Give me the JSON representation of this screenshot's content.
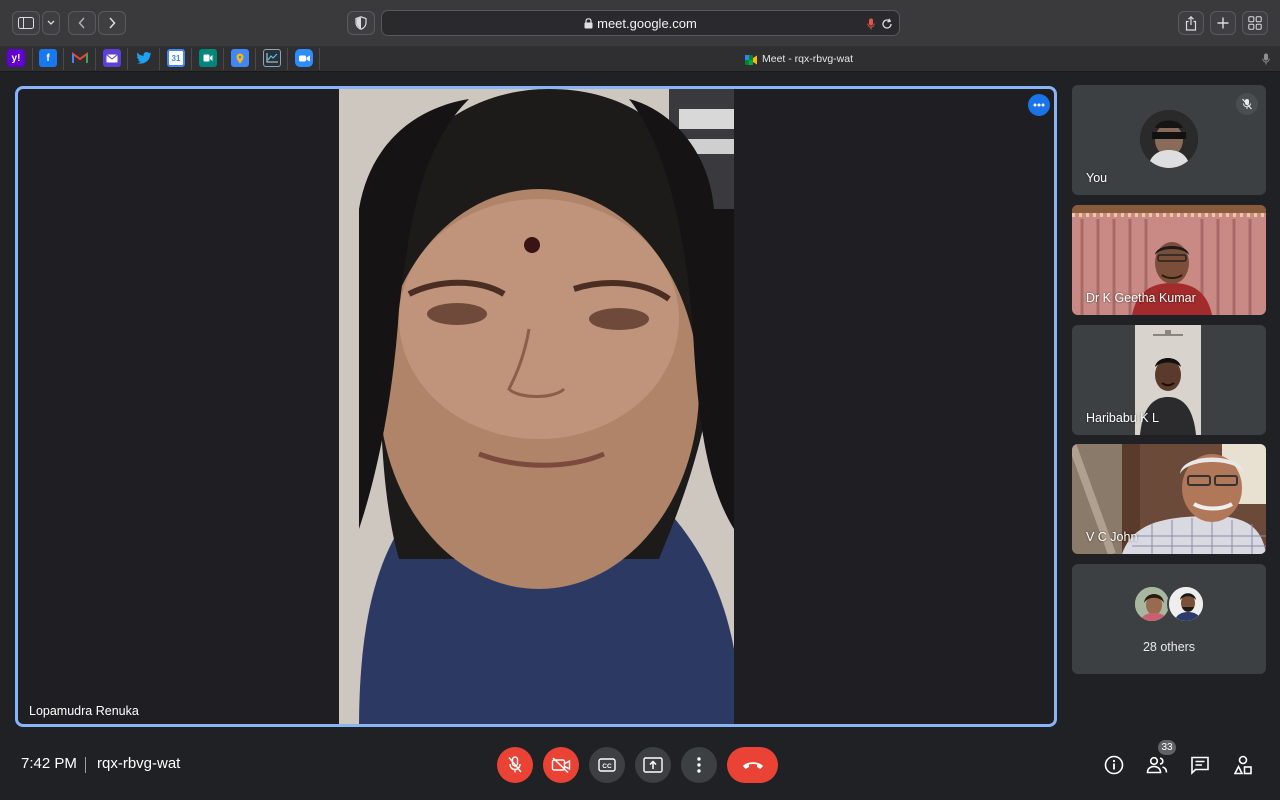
{
  "browser": {
    "url": "meet.google.com",
    "tab_title": "Meet - rqx-rbvg-wat",
    "bookmarks": [
      {
        "name": "yahoo",
        "glyph": "y!",
        "color": "#6001d2"
      },
      {
        "name": "facebook",
        "glyph": "f",
        "color": "#1877f2"
      },
      {
        "name": "gmail",
        "glyph": "M",
        "color": "#ffffff"
      },
      {
        "name": "mail",
        "glyph": "",
        "color": "#5b3fd6"
      },
      {
        "name": "twitter",
        "glyph": "",
        "color": "#1da1f2"
      },
      {
        "name": "calendar",
        "glyph": "31",
        "color": "#4285f4"
      },
      {
        "name": "meet",
        "glyph": "",
        "color": "#00897b"
      },
      {
        "name": "maps",
        "glyph": "",
        "color": "#4285f4"
      },
      {
        "name": "analytics",
        "glyph": "",
        "color": "#263238"
      },
      {
        "name": "zoom",
        "glyph": "",
        "color": "#2d8cff"
      }
    ]
  },
  "main_speaker": {
    "name": "Lopamudra Renuka"
  },
  "participants": [
    {
      "name": "You",
      "muted": true
    },
    {
      "name": "Dr K Geetha Kumar"
    },
    {
      "name": "Haribabu K L"
    },
    {
      "name": "V C John"
    }
  ],
  "others": {
    "label": "28 others"
  },
  "meeting": {
    "time": "7:42 PM",
    "code": "rqx-rbvg-wat",
    "people_count": "33"
  },
  "colors": {
    "accent": "#8ab4f8",
    "danger": "#ea4335",
    "background": "#202124"
  }
}
